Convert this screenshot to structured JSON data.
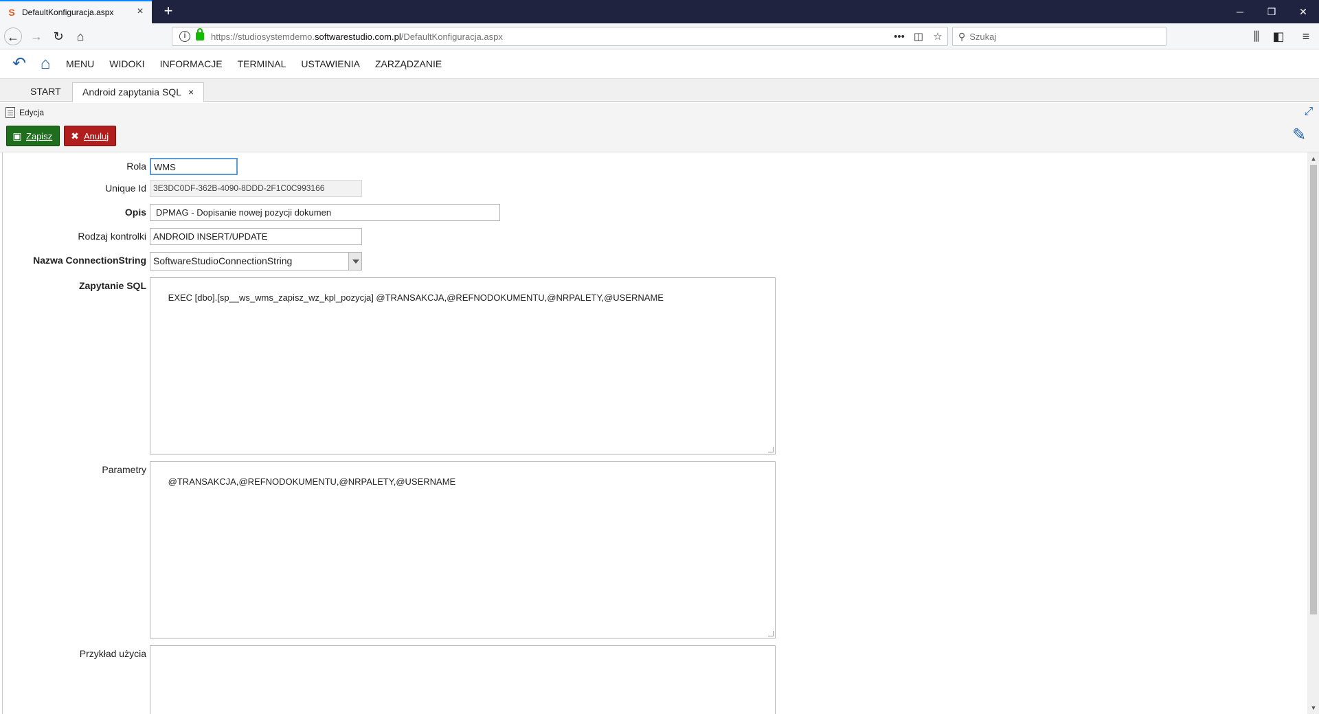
{
  "browser": {
    "tab_title": "DefaultKonfiguracja.aspx",
    "tab_close": "×",
    "new_tab": "+",
    "favicon": "S",
    "url_prefix": "https://studiosystemdemo.",
    "url_domain": "softwarestudio.com.pl",
    "url_path": "/DefaultKonfiguracja.aspx",
    "search_placeholder": "Szukaj",
    "icons": [
      "back-icon",
      "forward-icon",
      "reload-icon",
      "home-icon",
      "page-actions-icon",
      "pocket-icon",
      "bookmark-star-icon",
      "library-icon",
      "sidebar-icon",
      "hamburger-menu-icon"
    ]
  },
  "window": {
    "minimize": "─",
    "restore": "❐",
    "close": "✕"
  },
  "app": {
    "menu": [
      "MENU",
      "WIDOKI",
      "INFORMACJE",
      "TERMINAL",
      "USTAWIENIA",
      "ZARZĄDZANIE"
    ],
    "tabs": {
      "start": "START",
      "active": "Android zapytania SQL",
      "active_close": "×"
    },
    "panel_title": "Edycja",
    "toolbar": {
      "save": "Zapisz",
      "cancel": "Anuluj"
    }
  },
  "form": {
    "rola": {
      "label": "Rola",
      "value": "WMS"
    },
    "unique_id": {
      "label": "Unique Id",
      "value": "3E3DC0DF-362B-4090-8DDD-2F1C0C993166"
    },
    "opis": {
      "label": "Opis",
      "value": "DPMAG - Dopisanie nowej pozycji dokumen"
    },
    "rodzaj": {
      "label": "Rodzaj kontrolki",
      "value": "ANDROID INSERT/UPDATE"
    },
    "connection": {
      "label": "Nazwa ConnectionString",
      "value": "SoftwareStudioConnectionString"
    },
    "sql": {
      "label": "Zapytanie SQL",
      "value": "EXEC [dbo].[sp__ws_wms_zapisz_wz_kpl_pozycja] @TRANSAKCJA,@REFNODOKUMENTU,@NRPALETY,@USERNAME"
    },
    "parametry": {
      "label": "Parametry",
      "value": "@TRANSAKCJA,@REFNODOKUMENTU,@NRPALETY,@USERNAME"
    },
    "przyklad": {
      "label": "Przykład użycia",
      "value": ""
    }
  },
  "colors": {
    "save": "#1e6e1e",
    "cancel": "#b01e1e",
    "accent": "#1f5fa8",
    "titlebar": "#202340"
  }
}
